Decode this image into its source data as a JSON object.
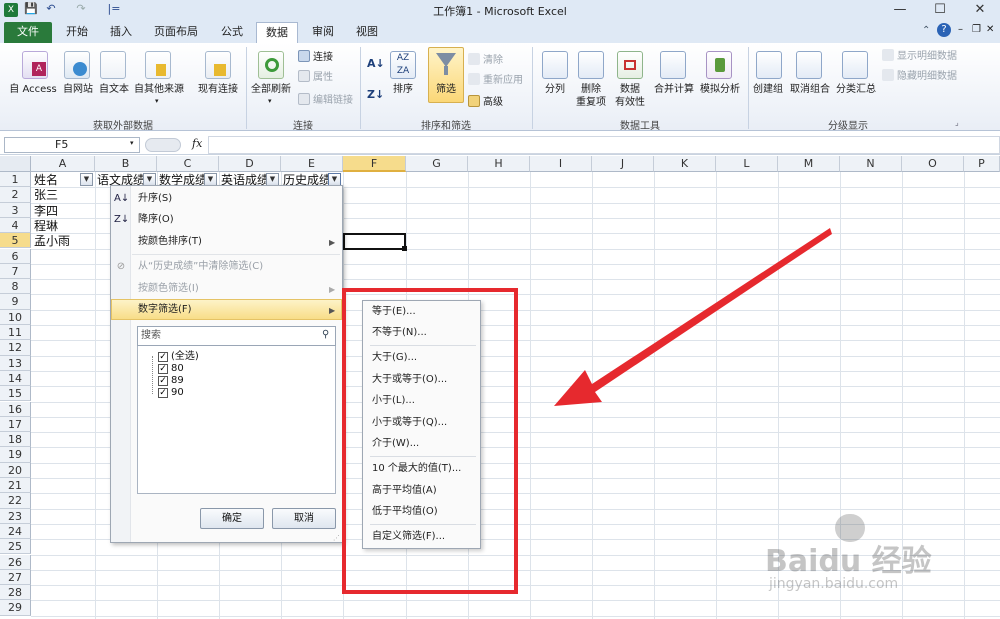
{
  "window": {
    "title": "工作簿1 - Microsoft Excel",
    "quick_access_sep": "|="
  },
  "tabs": [
    "文件",
    "开始",
    "插入",
    "页面布局",
    "公式",
    "数据",
    "审阅",
    "视图"
  ],
  "ribbon": {
    "group_external": {
      "label": "获取外部数据",
      "buttons": [
        "自 Access",
        "自网站",
        "自文本",
        "自其他来源",
        "现有连接"
      ]
    },
    "group_connections": {
      "label": "连接",
      "big": "全部刷新",
      "small": [
        "连接",
        "属性",
        "编辑链接"
      ]
    },
    "group_sort": {
      "label": "排序和筛选",
      "sort": "排序",
      "filter": "筛选",
      "small": [
        "清除",
        "重新应用",
        "高级"
      ]
    },
    "group_tools": {
      "label": "数据工具",
      "buttons": [
        "分列",
        "删除重复项",
        "数据有效性",
        "合并计算",
        "模拟分析"
      ],
      "remove_dup_line1": "删除",
      "remove_dup_line2": "重复项",
      "validity_line1": "数据",
      "validity_line2": "有效性"
    },
    "group_outline": {
      "label": "分级显示",
      "buttons": [
        "创建组",
        "取消组合",
        "分类汇总"
      ],
      "small": [
        "显示明细数据",
        "隐藏明细数据"
      ]
    }
  },
  "formula_bar": {
    "name_box": "F5",
    "fx": "fx",
    "formula": ""
  },
  "columns": [
    "A",
    "B",
    "C",
    "D",
    "E",
    "F",
    "G",
    "H",
    "I",
    "J",
    "K",
    "L",
    "M",
    "N",
    "O",
    "P"
  ],
  "rows": [
    "1",
    "2",
    "3",
    "4",
    "5",
    "6",
    "7",
    "8",
    "9",
    "10",
    "11",
    "12",
    "13",
    "14",
    "15",
    "16",
    "17",
    "18",
    "19",
    "20",
    "21",
    "22",
    "23",
    "24",
    "25",
    "26",
    "27",
    "28",
    "29"
  ],
  "cells": {
    "headers": [
      "姓名",
      "语文成绩",
      "数学成绩",
      "英语成绩",
      "历史成绩"
    ],
    "names": [
      "张三",
      "李四",
      "程琳",
      "孟小雨"
    ]
  },
  "filter_menu": {
    "items": [
      "升序(S)",
      "降序(O)",
      "按颜色排序(T)",
      "从“历史成绩”中清除筛选(C)",
      "按颜色筛选(I)",
      "数字筛选(F)"
    ],
    "search_placeholder": "搜索",
    "values": [
      "(全选)",
      "80",
      "89",
      "90"
    ],
    "ok": "确定",
    "cancel": "取消"
  },
  "number_filter_submenu": [
    "等于(E)...",
    "不等于(N)...",
    "大于(G)...",
    "大于或等于(O)...",
    "小于(L)...",
    "小于或等于(Q)...",
    "介于(W)...",
    "10 个最大的值(T)...",
    "高于平均值(A)",
    "低于平均值(O)",
    "自定义筛选(F)..."
  ],
  "watermark": {
    "brand": "Baidu 经验",
    "url": "jingyan.baidu.com"
  },
  "colors": {
    "file_tab": "#2a7a3b",
    "highlight": "#f8dd88",
    "annotation": "#e6292e",
    "selection": "#000000"
  }
}
